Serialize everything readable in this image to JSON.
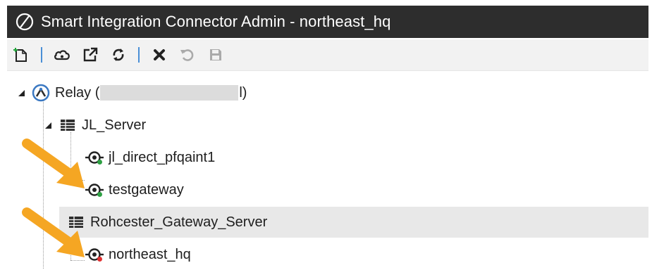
{
  "window": {
    "title": "Smart Integration Connector Admin - northeast_hq"
  },
  "toolbar": {
    "buttons": [
      {
        "icon": "new-document-icon",
        "state": "enabled"
      },
      {
        "icon": "cloud-icon",
        "state": "enabled"
      },
      {
        "icon": "external-link-icon",
        "state": "enabled"
      },
      {
        "icon": "refresh-icon",
        "state": "enabled"
      },
      {
        "icon": "delete-x-icon",
        "state": "enabled"
      },
      {
        "icon": "undo-icon",
        "state": "disabled"
      },
      {
        "icon": "save-icon",
        "state": "disabled"
      }
    ]
  },
  "tree": {
    "relay": {
      "label_prefix": "Relay (",
      "label_suffix": "l)"
    },
    "servers": [
      {
        "label": "JL_Server",
        "gateways": [
          {
            "label": "jl_direct_pfqaint1",
            "status": "online"
          },
          {
            "label": "testgateway",
            "status": "online"
          }
        ]
      },
      {
        "label": "Rohcester_Gateway_Server",
        "selected": true,
        "gateways": [
          {
            "label": "northeast_hq",
            "status": "offline"
          }
        ]
      }
    ]
  },
  "colors": {
    "titlebar": "#2d2d2d",
    "status_online": "#2ea043",
    "status_offline": "#e03030",
    "annotation_arrow": "#f5a623"
  }
}
